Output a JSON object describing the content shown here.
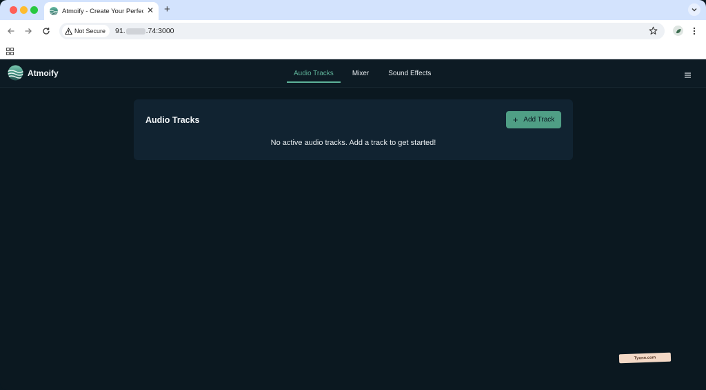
{
  "browser": {
    "tab": {
      "title": "Atmoify - Create Your Perfect"
    },
    "address": {
      "security_label": "Not Secure",
      "url_prefix": "91.",
      "url_suffix": ".74:3000"
    }
  },
  "app": {
    "brand": "Atmoify",
    "nav": [
      {
        "label": "Audio Tracks",
        "active": true
      },
      {
        "label": "Mixer",
        "active": false
      },
      {
        "label": "Sound Effects",
        "active": false
      }
    ],
    "panel": {
      "title": "Audio Tracks",
      "add_button_label": "Add Track",
      "empty_message": "No active audio tracks. Add a track to get started!"
    }
  },
  "watermark": "Tyone.com",
  "colors": {
    "accent": "#5fb49a",
    "button": "#4f9e85",
    "background": "#0b1820",
    "panel": "#112331"
  }
}
